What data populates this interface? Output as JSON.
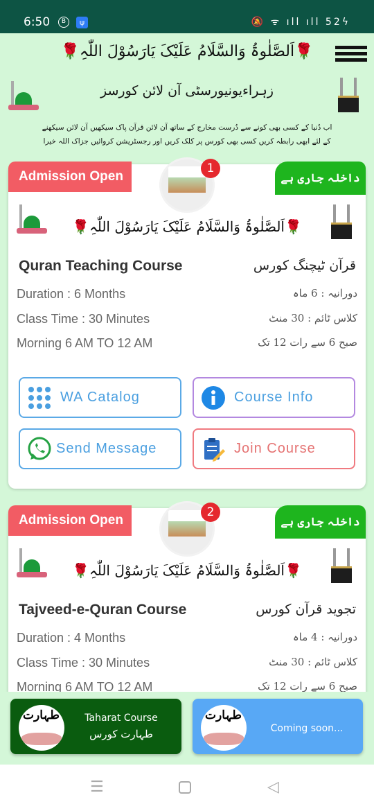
{
  "status_bar": {
    "time": "6:50",
    "battery": "52"
  },
  "header": {
    "greeting": "🌹اَلصَّلٰوۃُ وَالسَّلَامُ عَلَیْکَ یَارَسُوْلَ اللّٰہِ🌹",
    "title": "زہراءیونیورسٹی آن لائن کورسز",
    "description": "اب دُنیا کے کسی بھی کونے سے دُرست مخارج کے ساتھ آن لائن قرآن پاک سیکھیں آن لائن سیکھنے کے لئے ابھی رابطہ کریں کسی بھی کورس پر کلک کریں اور رجسٹریشن کروائیں جزاک اللہ خیرا"
  },
  "courses": [
    {
      "number": "1",
      "ribbon_left": "Admission Open",
      "ribbon_right": "داخلہ جاری ہے",
      "greeting": "🌹اَلصَّلٰوۃُ وَالسَّلَامُ عَلَیْکَ یَارَسُوْلَ اللّٰہِ🌹",
      "name": "Quran Teaching Course",
      "name_ur": "قرآن ٹیچنگ کورس",
      "duration": "Duration : 6 Months",
      "duration_ur": "دورانیہ : 6 ماہ",
      "class_time": "Class Time : 30 Minutes",
      "class_time_ur": "کلاس ٹائم : 30 منٹ",
      "timing": "Morning 6 AM TO 12 AM",
      "timing_ur": "صبح 6 سے رات 12 تک"
    },
    {
      "number": "2",
      "ribbon_left": "Admission Open",
      "ribbon_right": "داخلہ جاری ہے",
      "greeting": "🌹اَلصَّلٰوۃُ وَالسَّلَامُ عَلَیْکَ یَارَسُوْلَ اللّٰہِ🌹",
      "name": "Tajveed-e-Quran Course",
      "name_ur": "تجوید قرآن کورس",
      "duration": "Duration : 4 Months",
      "duration_ur": "دورانیہ : 4 ماہ",
      "class_time": "Class Time : 30 Minutes",
      "class_time_ur": "کلاس ٹائم : 30 منٹ",
      "timing": "Morning 6 AM TO 12 AM",
      "timing_ur": "صبح 6 سے رات 12 تک"
    }
  ],
  "buttons": {
    "wa_catalog": "WA Catalog",
    "course_info": "Course Info",
    "send_message": "Send Message",
    "join_course": "Join Course"
  },
  "bottom": {
    "taharat": "Taharat Course",
    "taharat_ur": "طہارت کورس",
    "coming": "Coming soon...",
    "logo_text": "طہارت"
  },
  "colors": {
    "status_bar": "#0d5444",
    "background": "#d4f7d8",
    "ribbon_red": "#f25c64",
    "ribbon_green": "#1eb51e",
    "taharat_green": "#0a5c0f",
    "coming_blue": "#58a8f5"
  }
}
